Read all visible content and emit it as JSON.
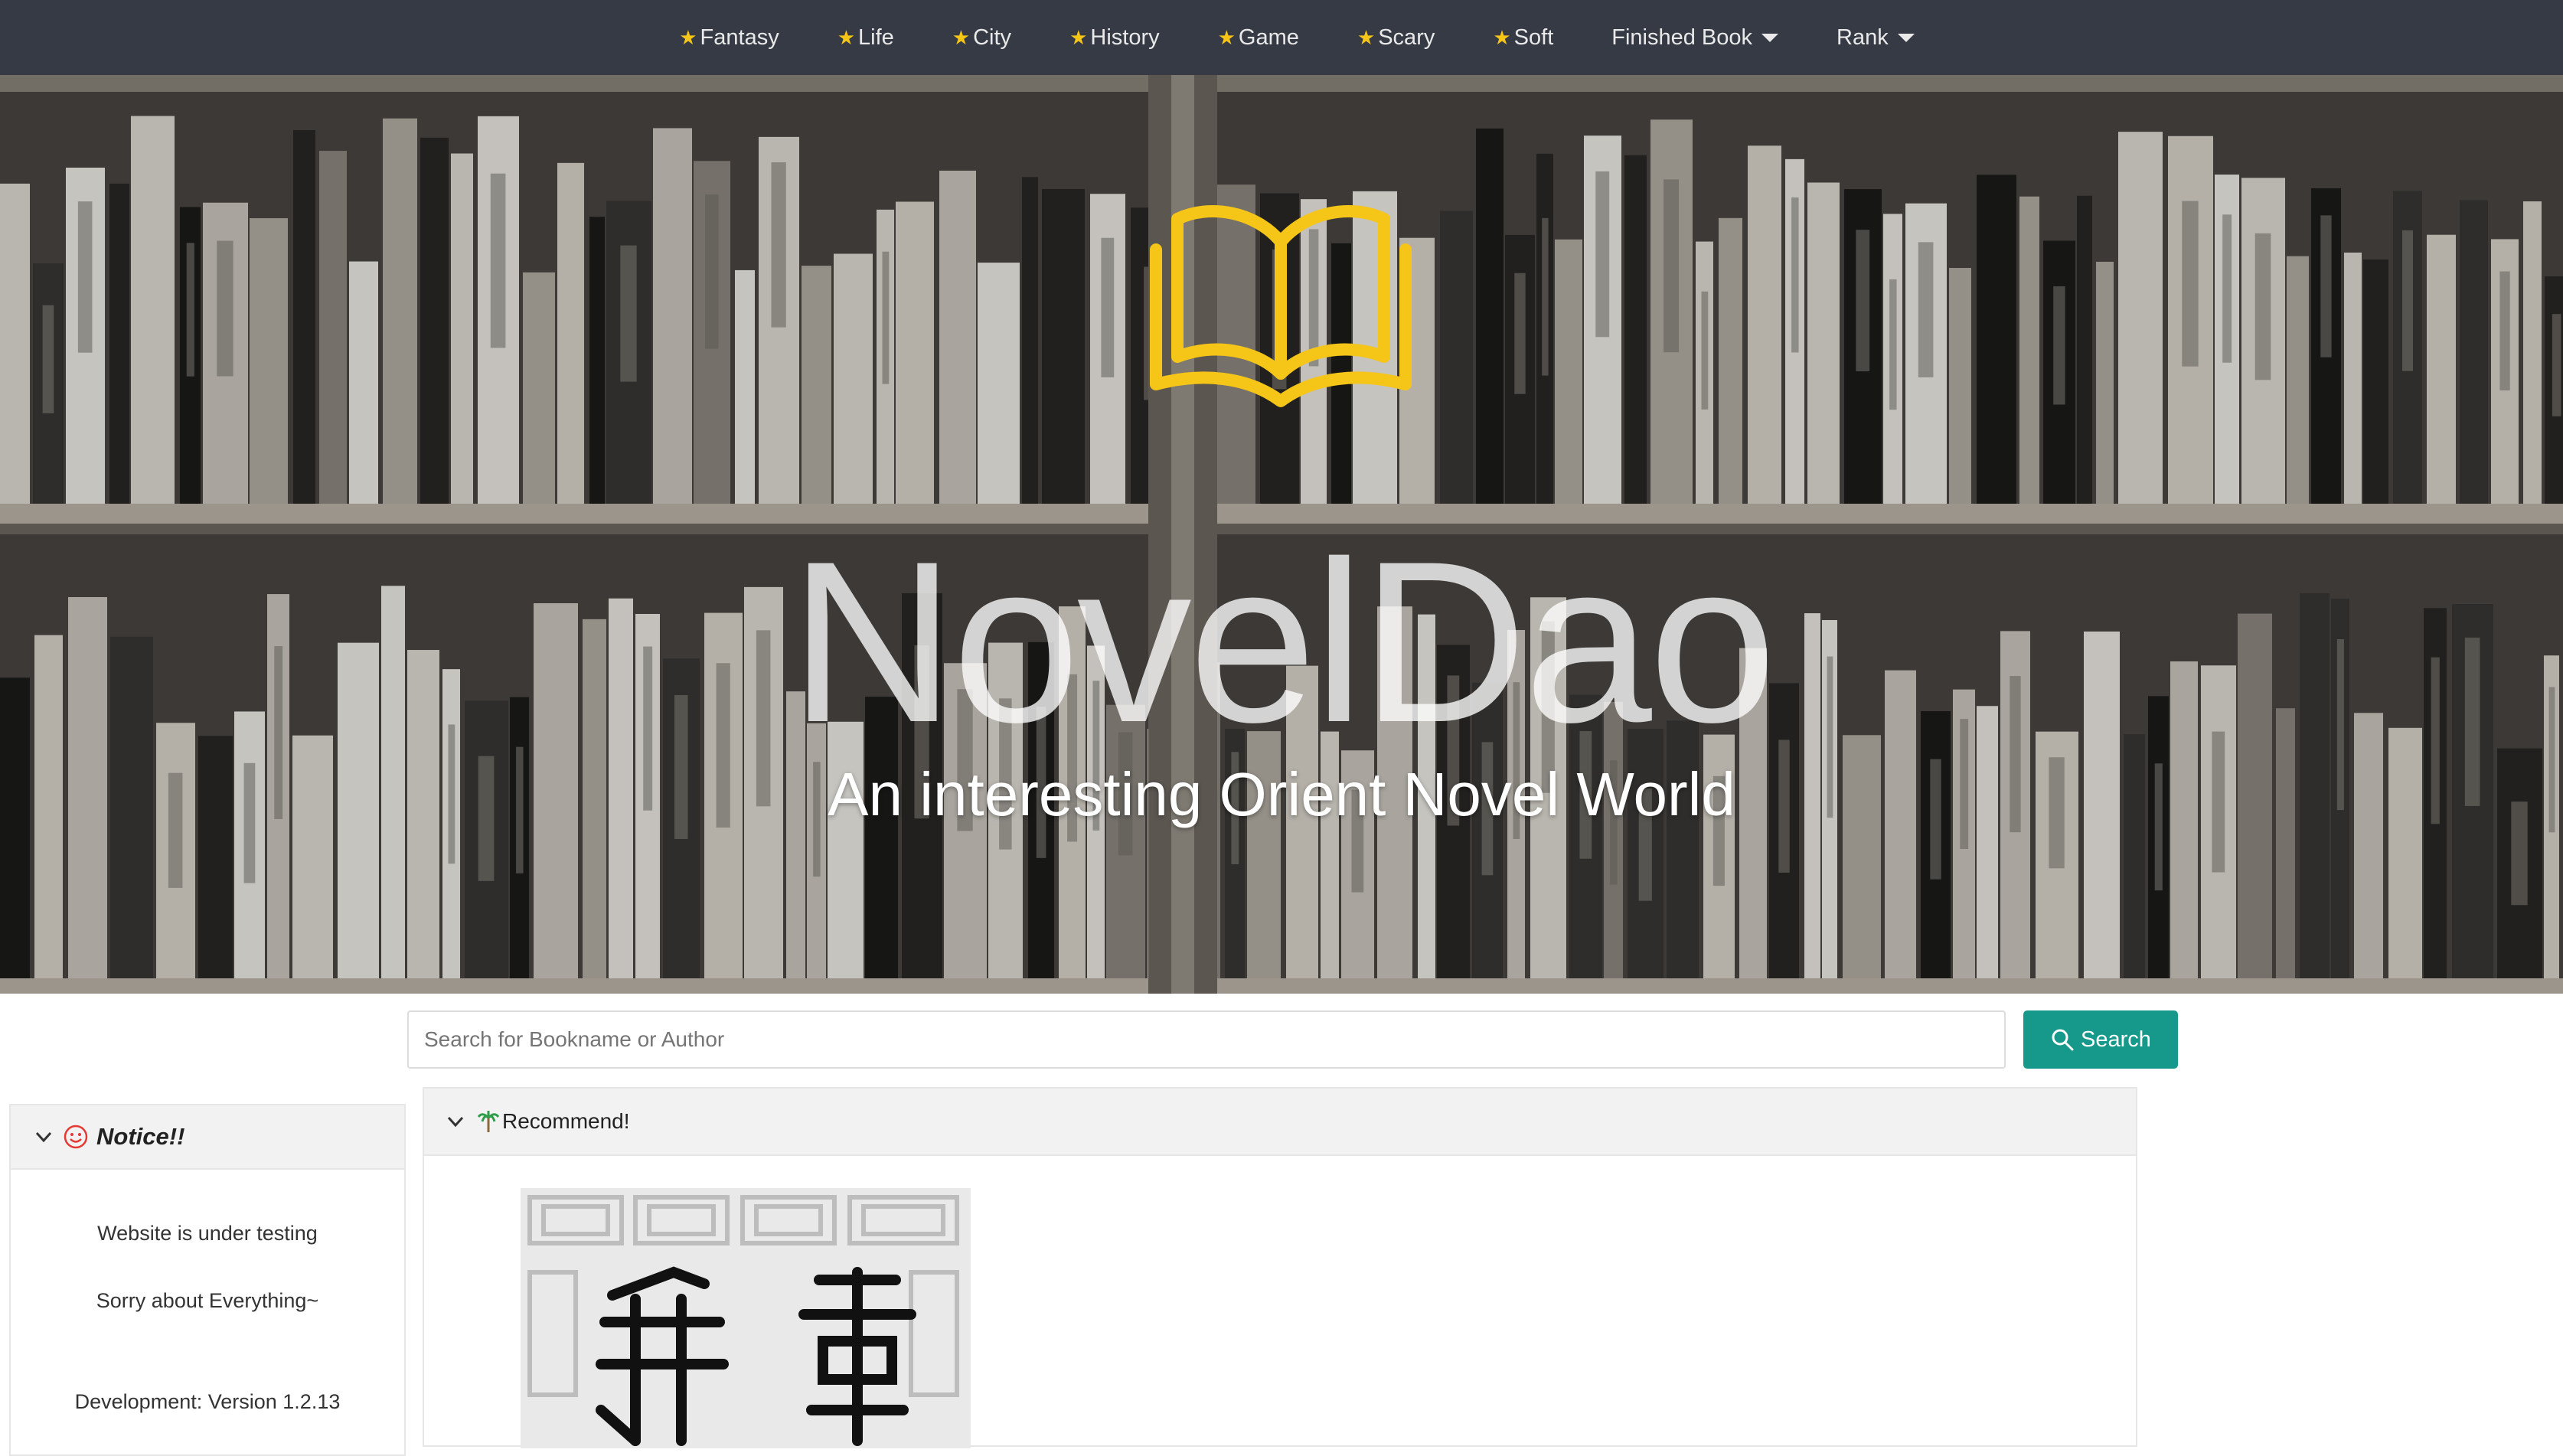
{
  "nav": {
    "items": [
      {
        "label": "Fantasy",
        "star": true,
        "dropdown": false
      },
      {
        "label": "Life",
        "star": true,
        "dropdown": false
      },
      {
        "label": "City",
        "star": true,
        "dropdown": false
      },
      {
        "label": "History",
        "star": true,
        "dropdown": false
      },
      {
        "label": "Game",
        "star": true,
        "dropdown": false
      },
      {
        "label": "Scary",
        "star": true,
        "dropdown": false
      },
      {
        "label": "Soft",
        "star": true,
        "dropdown": false
      },
      {
        "label": "Finished Book",
        "star": false,
        "dropdown": true
      },
      {
        "label": "Rank",
        "star": false,
        "dropdown": true
      }
    ]
  },
  "hero": {
    "title": "NovelDao",
    "subtitle": "An interesting Orient Novel World",
    "logo_icon": "open-book-icon",
    "logo_color": "#f5c518"
  },
  "search": {
    "placeholder": "Search for Bookname or Author",
    "value": "",
    "button_label": "Search",
    "button_color": "#16998a"
  },
  "notice": {
    "title": "Notice!!",
    "line1": "Website is under testing",
    "line2": "Sorry about Everything~",
    "version": "Development: Version 1.2.13"
  },
  "recommend": {
    "title": "Recommend!"
  },
  "colors": {
    "nav_bg": "#353a45",
    "star": "#f5c518",
    "accent": "#16998a"
  }
}
